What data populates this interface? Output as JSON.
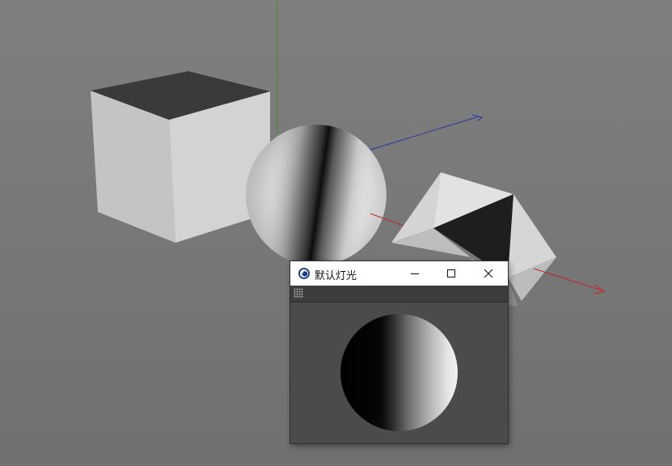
{
  "window": {
    "title": "默认灯光",
    "app_icon": "cinema4d-icon",
    "controls": {
      "minimize": "minimize-icon",
      "maximize": "maximize-icon",
      "close": "close-icon"
    }
  },
  "viewport": {
    "objects": [
      "cube",
      "sphere",
      "octahedron"
    ],
    "axes": {
      "y_color": "#3f8f3f",
      "x_color": "#cc2222",
      "z_color": "#2233aa"
    },
    "background_color": "#7a7a7a"
  },
  "preview": {
    "object": "sphere"
  }
}
